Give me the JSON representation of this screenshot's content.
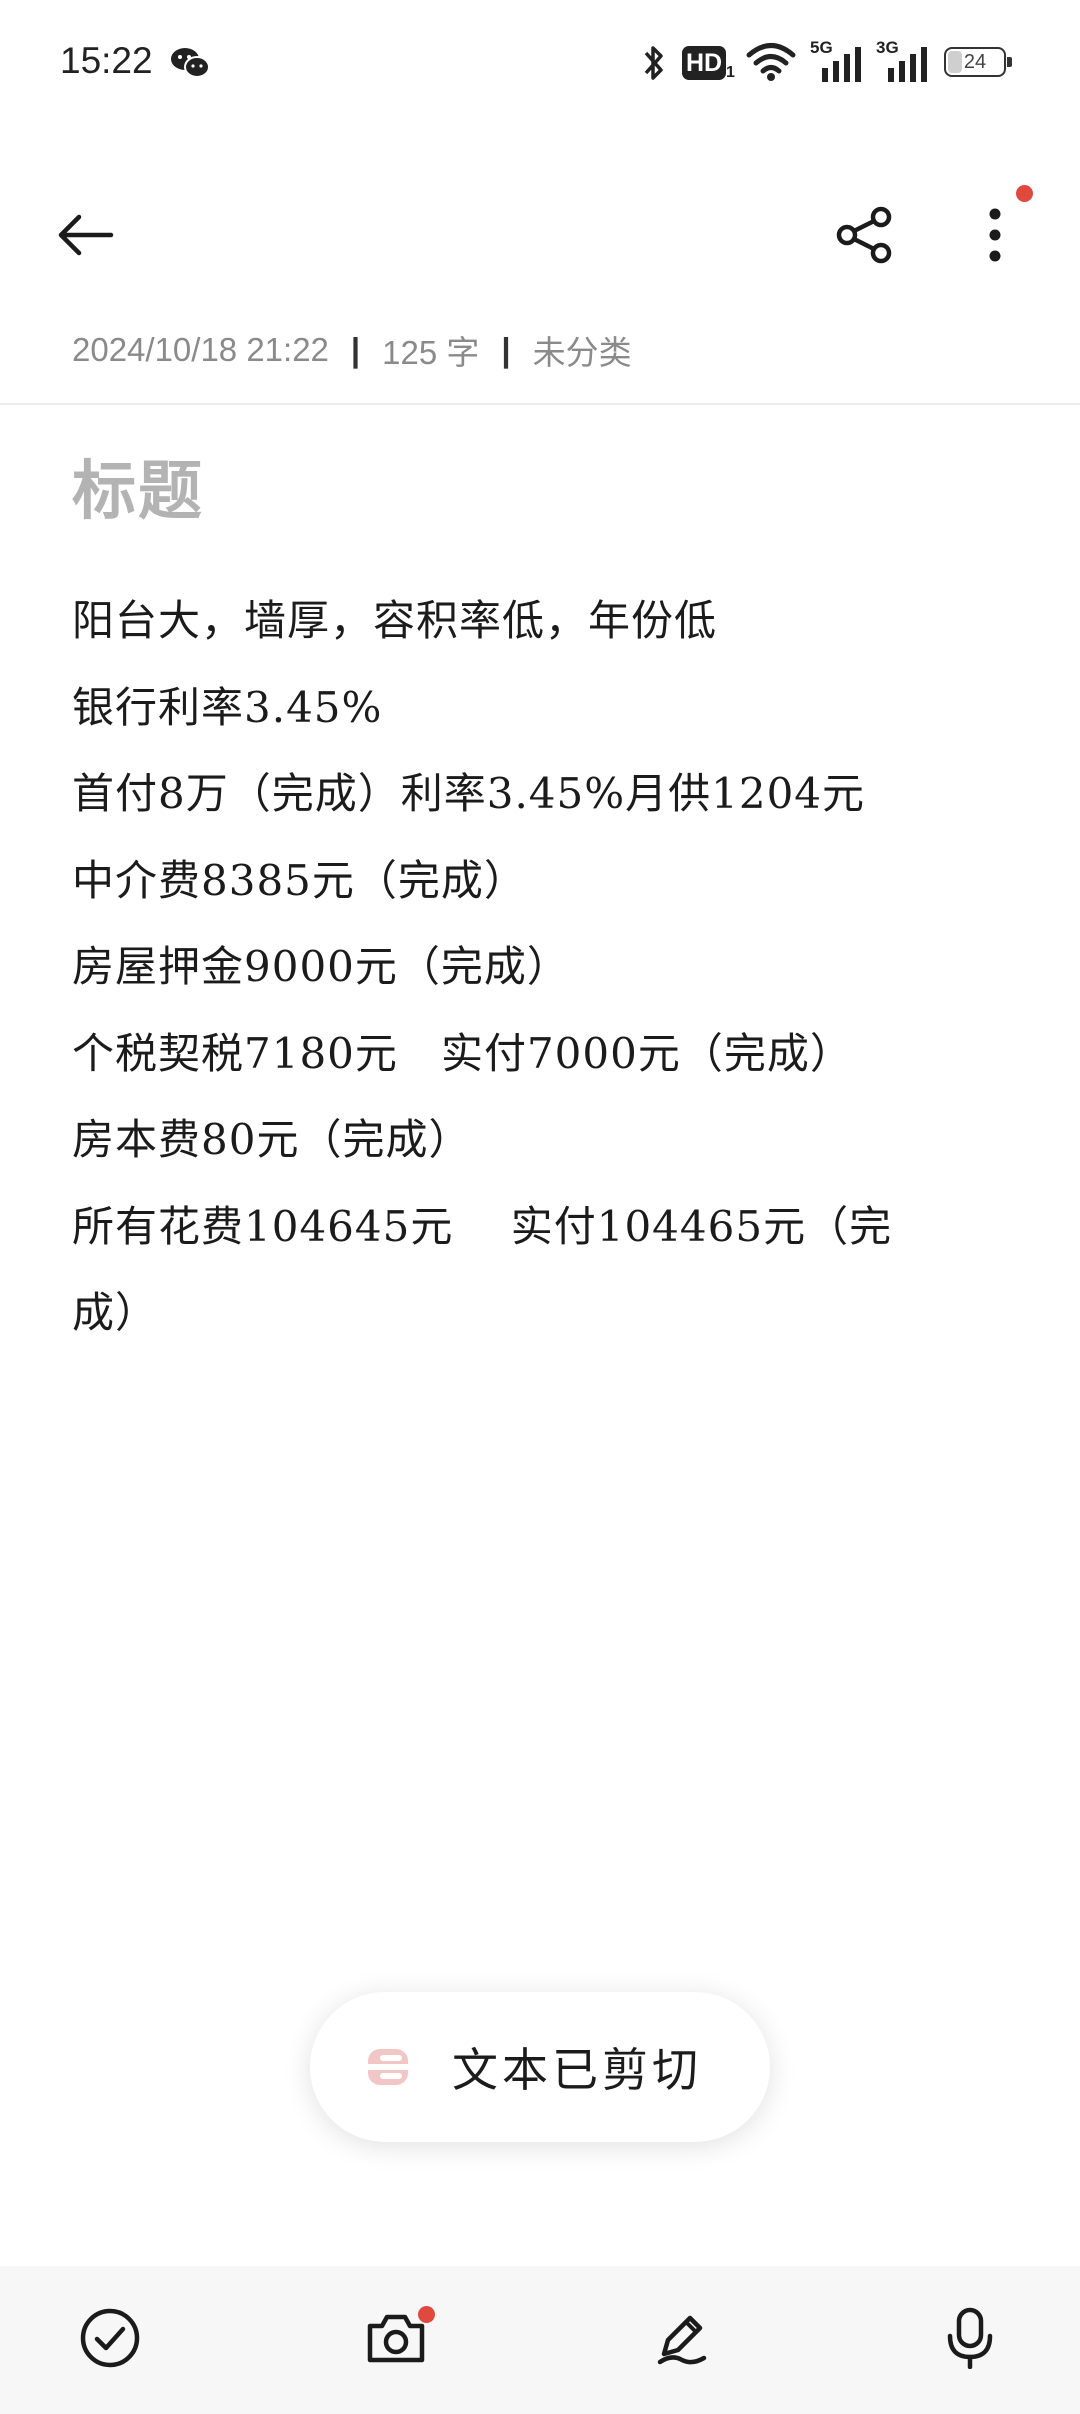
{
  "status_bar": {
    "time": "15:22",
    "battery": "24",
    "net_5g": "5G",
    "net_3g": "3G",
    "hd": "HD",
    "hd_sub": "1"
  },
  "top_bar": {
    "back_icon": "arrow-left-icon",
    "share_icon": "share-icon",
    "more_icon": "more-vertical-icon",
    "accent": "#e0493d"
  },
  "meta": {
    "datetime": "2024/10/18 21:22",
    "separator": "|",
    "word_count": "125 字",
    "category": "未分类"
  },
  "note": {
    "title_placeholder": "标题",
    "lines": [
      "阳台大，墙厚，容积率低，年份低",
      "银行利率3.45%",
      "首付8万（完成）利率3.45%月供1204元",
      "中介费8385元（完成）",
      "房屋押金9000元（完成）",
      "个税契税7180元   实付7000元（完成）",
      "房本费80元（完成）",
      "所有花费104645元    实付104465元（完",
      "成）"
    ]
  },
  "toast": {
    "text": "文本已剪切",
    "icon": "cut-icon"
  },
  "bottom_bar": {
    "items": [
      "checklist-icon",
      "camera-icon",
      "pen-icon",
      "microphone-icon"
    ]
  }
}
